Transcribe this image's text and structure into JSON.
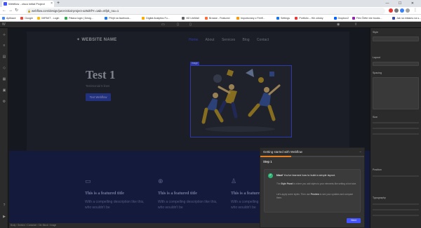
{
  "browser": {
    "tab_title": "Webflow - zisco initial Project",
    "url": "webflow.com/design/jarot-initial-project-a25d0f?r=1&b=ntfpk_ruu=1",
    "new_tab": "+",
    "window_controls": "— ☐ ✕",
    "bookmarks": [
      {
        "label": "Aplikace",
        "color": "#4285f4"
      },
      {
        "label": "Google",
        "color": "#ea4335"
      },
      {
        "label": "IMPAKT - Login",
        "color": "#fbbc05"
      },
      {
        "label": "Pálava login | Desig...",
        "color": "#34a853"
      },
      {
        "label": "Přejít na facebook...",
        "color": "#1877f2"
      },
      {
        "label": "Digital Analytics Fu...",
        "color": "#f9ab00"
      },
      {
        "label": "M2 LiteMail",
        "color": "#5f6368"
      },
      {
        "label": "Browse - Featured",
        "color": "#ff6b35"
      },
      {
        "label": "Importovány z Fireff...",
        "color": "#ff9500"
      },
      {
        "label": "Settings",
        "color": "#1a73e8"
      },
      {
        "label": "Portfolio – Hle zdroky",
        "color": "#e53935"
      },
      {
        "label": "Dropbox2",
        "color": "#0061ff"
      },
      {
        "label": "Film Čtěte vše books...",
        "color": "#8e24aa"
      },
      {
        "label": "Jak na reklamu na s...",
        "color": "#3949ab"
      }
    ]
  },
  "site": {
    "logo": "WEBSITE NAME",
    "nav": [
      "Home",
      "About",
      "Services",
      "Blog",
      "Contact"
    ],
    "hero_title": "Test 1",
    "hero_subtitle": "Testimonial 5 lines",
    "hero_button": "Text Webflow",
    "image_tag": "Image",
    "features": [
      {
        "icon": "▭",
        "title": "This is a featured title",
        "desc": "With a compelling description like this, who wouldn't be"
      },
      {
        "icon": "⊕",
        "title": "This is a featured title",
        "desc": "With a compelling description like this, who wouldn't be"
      },
      {
        "icon": "♙",
        "title": "This is a featured title",
        "desc": "With a compelling description like this, who wouldn't be"
      }
    ]
  },
  "getting_started": {
    "title": "Getting started with Webflow",
    "minimize": "–",
    "progress": 0.3,
    "step": "Step 1",
    "message_bold": "Nice!",
    "message": " You've learned how to build a simple layout.",
    "p1_pre": "The ",
    "p1_bold": "Style Panel",
    "p1_post": " is where you add styles to your elements like setting a font size.",
    "p2_pre": "Let's apply some styles. Then use ",
    "p2_bold": "Preview",
    "p2_post": " to see your updates and compare them.",
    "next": "Next"
  },
  "statusbar": "Body  ›  Section  ›  Container  ›  Div Block  ›  Image",
  "right_panel": {
    "sections": [
      "Style",
      "Layout",
      "Spacing",
      "Size",
      "Position",
      "Typography"
    ]
  }
}
